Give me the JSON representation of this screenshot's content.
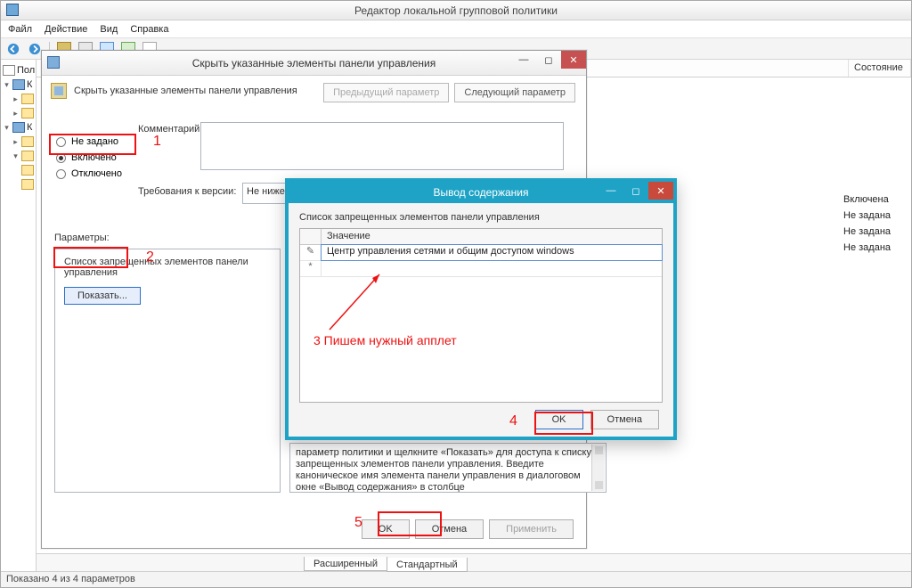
{
  "main": {
    "title": "Редактор локальной групповой политики",
    "menu": {
      "file": "Файл",
      "action": "Действие",
      "view": "Вид",
      "help": "Справка"
    },
    "tree_header": "Поли",
    "tree_root": "К",
    "tree_k": "К",
    "list_header": {
      "col2": "Состояние"
    },
    "states": {
      "r1": "Включена",
      "r2": "Не задана",
      "r3": "Не задана",
      "r4": "Не задана"
    },
    "tabs": {
      "ext": "Расширенный",
      "std": "Стандартный"
    },
    "status": "Показано 4 из 4 параметров"
  },
  "dlg": {
    "title": "Скрыть указанные элементы панели управления",
    "subtitle": "Скрыть указанные элементы панели управления",
    "nav_prev": "Предыдущий параметр",
    "nav_next": "Следующий параметр",
    "radio": {
      "none": "Не задано",
      "on": "Включено",
      "off": "Отключено"
    },
    "comment_label": "Комментарий:",
    "req_label": "Требования к версии:",
    "req_value": "Не ниже",
    "params_label": "Параметры:",
    "params_caption": "Список запрещенных элементов панели управления",
    "show_btn": "Показать...",
    "help_text": "параметр политики и щелкните «Показать» для доступа к списку запрещенных элементов панели управления. Введите каноническое имя элемента панели управления в диалоговом окне «Вывод содержания» в столбце",
    "btn_ok": "OK",
    "btn_cancel": "Отмена",
    "btn_apply": "Применить"
  },
  "modal": {
    "title": "Вывод содержания",
    "header": "Список запрещенных элементов панели управления",
    "col_value": "Значение",
    "row1_value": "Центр управления сетями и общим доступом windows",
    "row_new_marker": "*",
    "row_edit_marker": "✎",
    "btn_ok": "OK",
    "btn_cancel": "Отмена"
  },
  "anno": {
    "n1": "1",
    "n2": "2",
    "n3": "3  Пишем нужный апплет",
    "n4": "4",
    "n5": "5"
  }
}
